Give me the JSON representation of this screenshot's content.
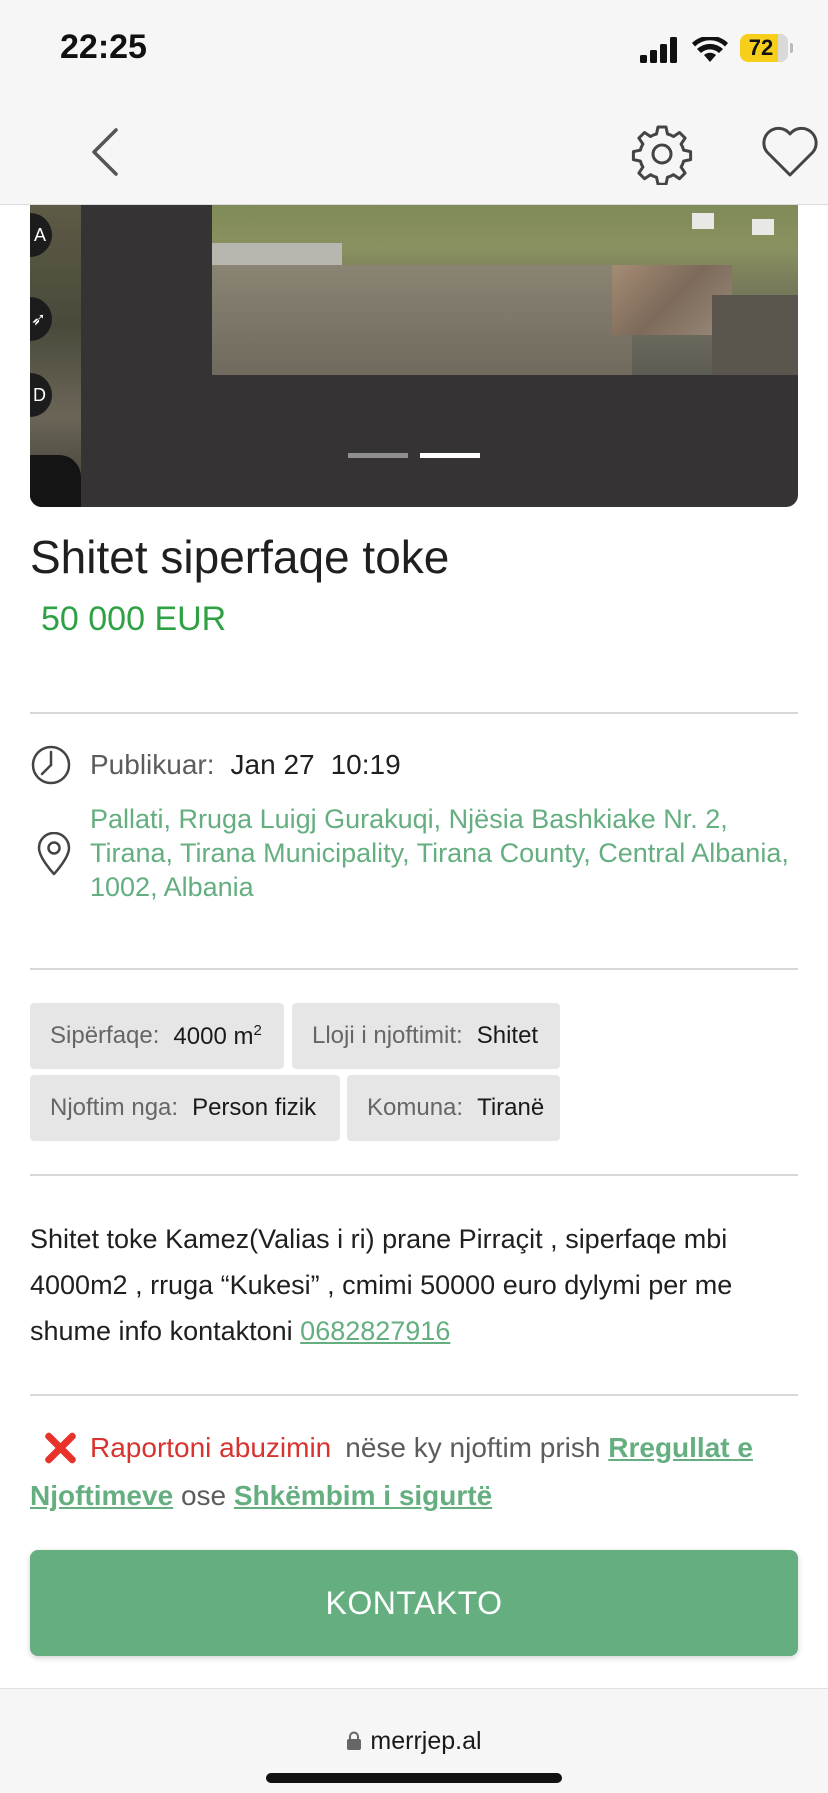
{
  "status_bar": {
    "time": "22:25",
    "battery": "72"
  },
  "nav": {
    "back_icon": "chevron-left-icon",
    "settings_icon": "gear-icon",
    "favorite_icon": "heart-icon"
  },
  "gallery": {
    "total_slides": 2,
    "active_slide": 2
  },
  "listing": {
    "title": "Shitet siperfaqe toke",
    "price": "50 000 EUR",
    "published_label": "Publikuar:",
    "published_date": "Jan 27",
    "published_time": "10:19",
    "address": "Pallati, Rruga Luigj Gurakuqi, Njësia Bashkiake Nr. 2, Tirana, Tirana Municipality, Tirana County, Central Albania, 1002, Albania"
  },
  "attributes": [
    {
      "key": "Sipërfaqe:",
      "value": "4000 m",
      "sup": "2"
    },
    {
      "key": "Lloji i njoftimit:",
      "value": "Shitet"
    },
    {
      "key": "Njoftim nga:",
      "value": "Person fizik"
    },
    {
      "key": "Komuna:",
      "value": "Tiranë"
    }
  ],
  "description": {
    "text": "Shitet toke Kamez(Valias i ri) prane Pirraçit , siperfaqe mbi 4000m2 , rruga “Kukesi” , cmimi 50000 euro dylymi per me shume info kontaktoni ",
    "phone": "0682827916"
  },
  "report": {
    "label": "Raportoni abuzimin",
    "text1": "nëse ky njoftim prish",
    "link1": "Rregullat e Njoftimeve",
    "text2": "ose",
    "link2": "Shkëmbim i sigurtë"
  },
  "contact_button": "KONTAKTO",
  "bottom": {
    "url": "merrjep.al"
  },
  "colors": {
    "accent_green": "#64ae80",
    "price_green": "#2fa144",
    "report_red": "#d8332e"
  }
}
